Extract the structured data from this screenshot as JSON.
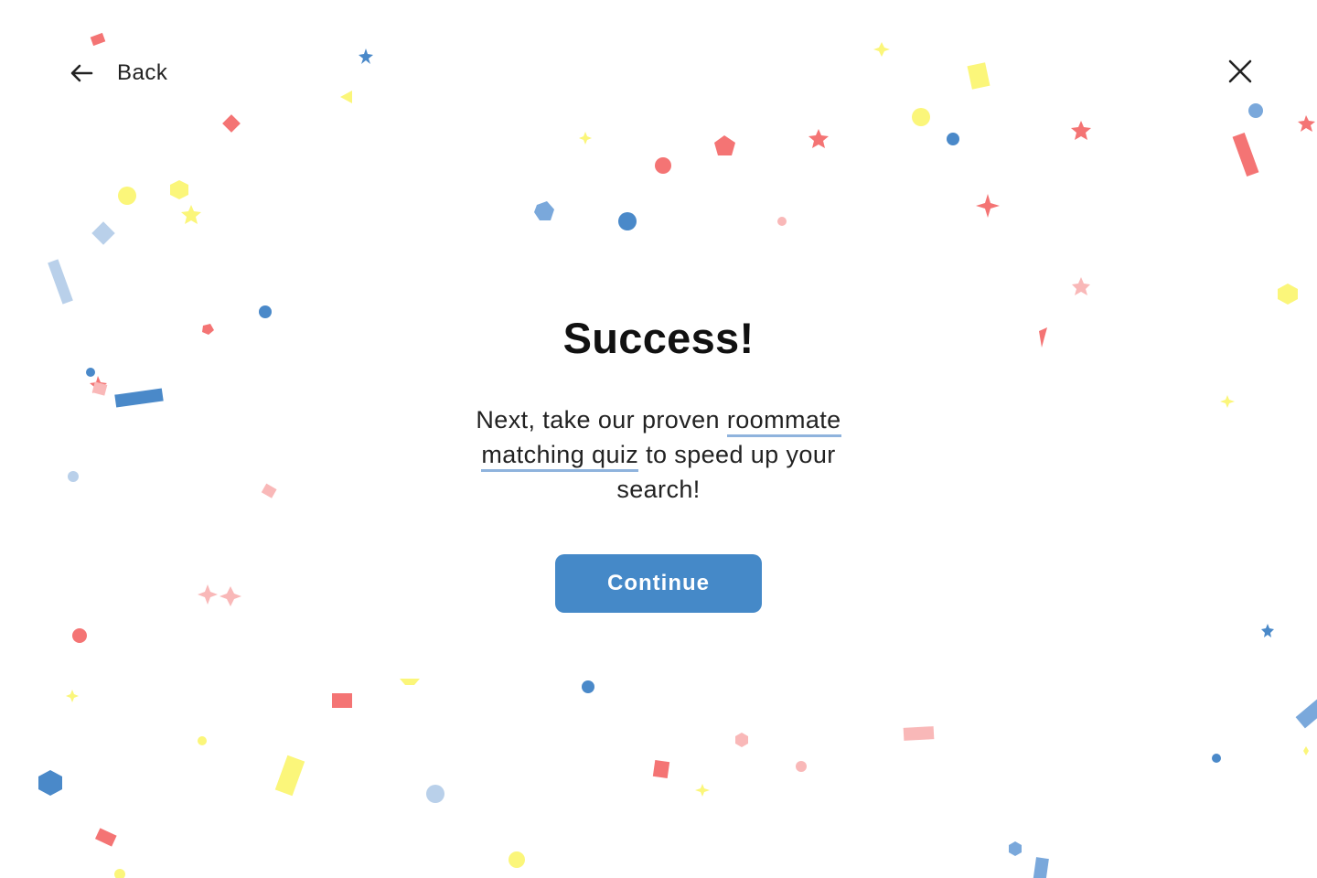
{
  "nav": {
    "back_label": "Back",
    "back_icon": "arrow-left-icon",
    "close_icon": "close-icon"
  },
  "main": {
    "title": "Success!",
    "message_before": "Next, take our proven",
    "link_text": "roommate matching quiz",
    "message_after": "to speed up your search!",
    "continue_label": "Continue"
  },
  "colors": {
    "accent": "#4589c8",
    "link_underline": "#8fb3dd",
    "confetti_red": "#f47474",
    "confetti_yellow": "#fbf67a",
    "confetti_blue": "#4a89c9",
    "confetti_light_blue": "#b9d0ea",
    "confetti_pink": "#f9b8b8"
  }
}
